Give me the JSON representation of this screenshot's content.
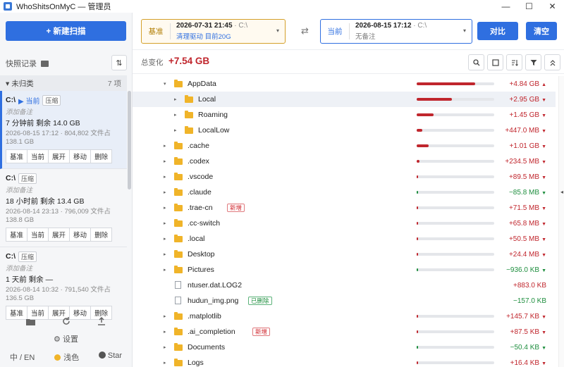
{
  "window": {
    "title": "WhoShitsOnMyC — 管理员",
    "controls": {
      "minimize": "—",
      "maximize": "☐",
      "close": "✕"
    }
  },
  "sidebar": {
    "new_scan": "+ 新建扫描",
    "snapshots_title": "快照记录",
    "sort_icon": "⇅",
    "group": {
      "name": "▾ 未归类",
      "count": "7 项"
    },
    "snapshots": [
      {
        "drive": "C:\\",
        "current": "▶ 当前",
        "tag": "压缩",
        "note": "添加备注",
        "summary": "7 分钟前 剩余 14.0 GB",
        "meta": "2026-08-15 17:12 · 804,802 文件占 138.1 GB",
        "actions": [
          "基准",
          "当前",
          "展开",
          "移动",
          "删除"
        ]
      },
      {
        "drive": "C:\\",
        "current": "",
        "tag": "压缩",
        "note": "添加备注",
        "summary": "18 小时前 剩余 13.4 GB",
        "meta": "2026-08-14 23:13 · 796,009 文件占 138.8 GB",
        "actions": [
          "基准",
          "当前",
          "展开",
          "移动",
          "删除"
        ]
      },
      {
        "drive": "C:\\",
        "current": "",
        "tag": "压缩",
        "note": "添加备注",
        "summary": "1 天前 剩余 —",
        "meta": "2026-08-14 10:32 · 791,540 文件占 136.5 GB",
        "actions": [
          "基准",
          "当前",
          "展开",
          "移动",
          "删除"
        ]
      }
    ],
    "bottom_icons": [
      "folder-icon",
      "refresh-icon",
      "export-icon"
    ],
    "settings_label": "⚙ 设置",
    "lang": "中 / EN",
    "theme": "浅色",
    "star": "Star"
  },
  "compare": {
    "base": {
      "label": "基准",
      "date": "2026-07-31 21:45",
      "drive": "· C:\\",
      "note": "清理驱动 目前20G"
    },
    "current": {
      "label": "当前",
      "date": "2026-08-15 17:12",
      "drive": "· C:\\",
      "note": "无备注"
    },
    "swap_icon": "⇄",
    "compare_button": "对比",
    "cleanup_button": "清空"
  },
  "total": {
    "label": "总变化",
    "value": "+7.54 GB"
  },
  "toolbar_icons": [
    "search-icon",
    "expand-icon",
    "sort-icon",
    "filter-icon",
    "collapse-icon"
  ],
  "tree": [
    {
      "name": "AppData",
      "level": 1,
      "arrow": "▾",
      "type": "folder",
      "bar": 0.75,
      "delta": "+4.84 GB",
      "dir": "pos",
      "tri": "▲"
    },
    {
      "name": "Local",
      "level": 2,
      "arrow": "▸",
      "type": "folder",
      "bar": 0.45,
      "delta": "+2.95 GB",
      "dir": "pos",
      "tri": "▼",
      "selected": true
    },
    {
      "name": "Roaming",
      "level": 2,
      "arrow": "▸",
      "type": "folder",
      "bar": 0.22,
      "delta": "+1.45 GB",
      "dir": "pos",
      "tri": "▼"
    },
    {
      "name": "LocalLow",
      "level": 2,
      "arrow": "▸",
      "type": "folder",
      "bar": 0.07,
      "delta": "+447.0 MB",
      "dir": "pos",
      "tri": "▼"
    },
    {
      "name": ".cache",
      "level": 1,
      "arrow": "▸",
      "type": "folder",
      "bar": 0.15,
      "delta": "+1.01 GB",
      "dir": "pos",
      "tri": "▼"
    },
    {
      "name": ".codex",
      "level": 1,
      "arrow": "▸",
      "type": "folder",
      "bar": 0.04,
      "delta": "+234.5 MB",
      "dir": "pos",
      "tri": "▼"
    },
    {
      "name": ".vscode",
      "level": 1,
      "arrow": "▸",
      "type": "folder",
      "bar": 0.02,
      "delta": "+89.5 MB",
      "dir": "pos",
      "tri": "▼"
    },
    {
      "name": ".claude",
      "level": 1,
      "arrow": "▸",
      "type": "folder",
      "bar": 0.02,
      "delta": "−85.8 MB",
      "dir": "neg",
      "tri": "▼"
    },
    {
      "name": ".trae-cn",
      "level": 1,
      "arrow": "▸",
      "type": "folder",
      "bar": 0.015,
      "delta": "+71.5 MB",
      "dir": "pos",
      "tri": "▼",
      "badge": "新增",
      "badge_type": "new"
    },
    {
      "name": ".cc-switch",
      "level": 1,
      "arrow": "▸",
      "type": "folder",
      "bar": 0.015,
      "delta": "+65.8 MB",
      "dir": "pos",
      "tri": "▼"
    },
    {
      "name": ".local",
      "level": 1,
      "arrow": "▸",
      "type": "folder",
      "bar": 0.012,
      "delta": "+50.5 MB",
      "dir": "pos",
      "tri": "▼"
    },
    {
      "name": "Desktop",
      "level": 1,
      "arrow": "▸",
      "type": "folder",
      "bar": 0.008,
      "delta": "+24.4 MB",
      "dir": "pos",
      "tri": "▼"
    },
    {
      "name": "Pictures",
      "level": 1,
      "arrow": "▸",
      "type": "folder",
      "bar": 0.004,
      "delta": "−936.0 KB",
      "dir": "neg",
      "tri": "▼"
    },
    {
      "name": "ntuser.dat.LOG2",
      "level": 1,
      "arrow": "",
      "type": "file",
      "bar": 0,
      "delta": "+883.0 KB",
      "dir": "pos",
      "tri": ""
    },
    {
      "name": "hudun_img.png",
      "level": 1,
      "arrow": "",
      "type": "file",
      "bar": 0,
      "delta": "−157.0 KB",
      "dir": "neg",
      "tri": "",
      "badge": "已删除",
      "badge_type": "del"
    },
    {
      "name": ".matplotlib",
      "level": 1,
      "arrow": "▸",
      "type": "folder",
      "bar": 0.002,
      "delta": "+145.7 KB",
      "dir": "pos",
      "tri": "▼"
    },
    {
      "name": ".ai_completion",
      "level": 1,
      "arrow": "▸",
      "type": "folder",
      "bar": 0.002,
      "delta": "+87.5 KB",
      "dir": "pos",
      "tri": "▼",
      "badge": "新增",
      "badge_type": "new"
    },
    {
      "name": "Documents",
      "level": 1,
      "arrow": "▸",
      "type": "folder",
      "bar": 0.001,
      "delta": "−50.4 KB",
      "dir": "neg",
      "tri": "▼"
    },
    {
      "name": "Logs",
      "level": 1,
      "arrow": "▸",
      "type": "folder",
      "bar": 0.001,
      "delta": "+16.4 KB",
      "dir": "pos",
      "tri": "▼"
    }
  ],
  "colors": {
    "accent": "#2f6fe0",
    "positive": "#c0262d",
    "negative": "#1e8e3e",
    "folder": "#f0b429",
    "base_border": "#d4a02a"
  }
}
